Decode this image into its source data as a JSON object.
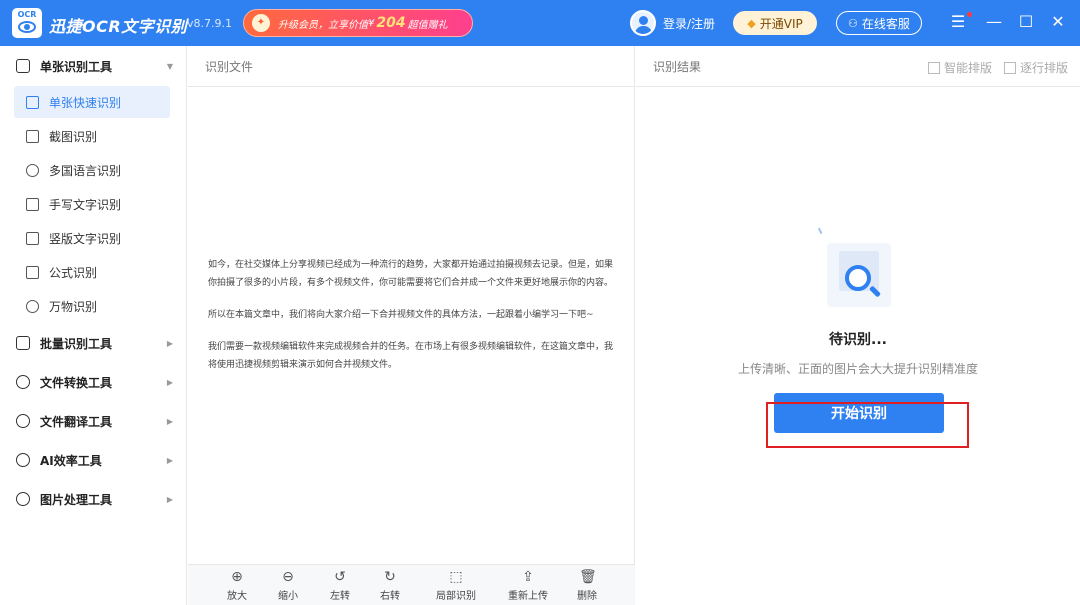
{
  "app": {
    "logo_text": "OCR",
    "name": "迅捷OCR文字识别",
    "version": "v8.7.9.1"
  },
  "promo": {
    "text_before": "升级会员，立享价值",
    "currency": "¥",
    "price": "204",
    "text_after": "超值赠礼"
  },
  "header": {
    "login_label": "登录/注册",
    "vip_label": "开通VIP",
    "service_label": "在线客服"
  },
  "sidebar": {
    "groups": [
      {
        "label": "单张识别工具"
      },
      {
        "label": "批量识别工具"
      },
      {
        "label": "文件转换工具"
      },
      {
        "label": "文件翻译工具"
      },
      {
        "label": "AI效率工具"
      },
      {
        "label": "图片处理工具"
      }
    ],
    "items": [
      {
        "label": "单张快速识别"
      },
      {
        "label": "截图识别"
      },
      {
        "label": "多国语言识别"
      },
      {
        "label": "手写文字识别"
      },
      {
        "label": "竖版文字识别"
      },
      {
        "label": "公式识别"
      },
      {
        "label": "万物识别"
      }
    ]
  },
  "left_pane": {
    "title": "识别文件",
    "paragraphs": [
      "如今，在社交媒体上分享视频已经成为一种流行的趋势，大家都开始通过拍摄视频去记录。但是，如果你拍摄了很多的小片段，有多个视频文件，你可能需要将它们合并成一个文件来更好地展示你的内容。",
      "所以在本篇文章中，我们将向大家介绍一下合并视频文件的具体方法，一起跟着小编学习一下吧~",
      "我们需要一款视频编辑软件来完成视频合并的任务。在市场上有很多视频编辑软件，在这篇文章中，我将使用迅捷视频剪辑来演示如何合并视频文件。"
    ],
    "tools": [
      {
        "label": "放大",
        "icon": "zoom-in-icon",
        "glyph": "⊕"
      },
      {
        "label": "缩小",
        "icon": "zoom-out-icon",
        "glyph": "⊖"
      },
      {
        "label": "左转",
        "icon": "rotate-left-icon",
        "glyph": "↺"
      },
      {
        "label": "右转",
        "icon": "rotate-right-icon",
        "glyph": "↻"
      },
      {
        "label": "局部识别",
        "icon": "partial-recognize-icon",
        "glyph": "⬚"
      },
      {
        "label": "重新上传",
        "icon": "upload-icon",
        "glyph": "⇪"
      },
      {
        "label": "删除",
        "icon": "trash-icon",
        "glyph": "🗑"
      }
    ]
  },
  "right_pane": {
    "title": "识别结果",
    "smart_layout_label": "智能排版",
    "line_layout_label": "逐行排版",
    "status_title": "待识别...",
    "status_hint": "上传清晰、正面的图片会大大提升识别精准度",
    "start_button": "开始识别"
  },
  "colors": {
    "brand_blue": "#2f80f0",
    "highlight_red": "#e02020"
  }
}
